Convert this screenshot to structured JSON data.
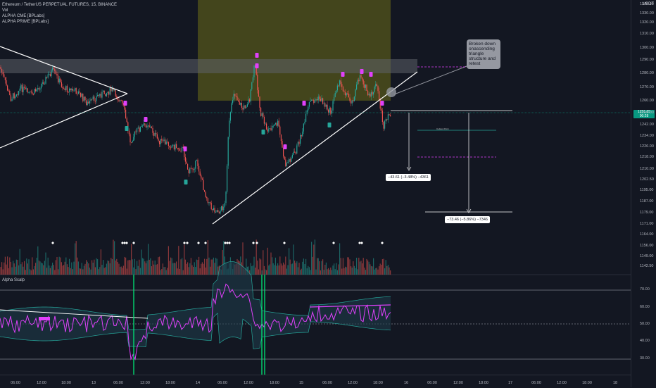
{
  "legend": {
    "title": "Ethereum / TetherUS PERPETUAL FUTURES, 15, BINANCE",
    "indicators": [
      "Vol",
      "ALPHA CME [BPLabs]",
      "ALPHA PRIME [BPLabs]"
    ]
  },
  "currency": "USDT",
  "price_axis": [
    "1340.00",
    "1330.00",
    "1320.00",
    "1310.00",
    "1300.00",
    "1290.00",
    "1280.00",
    "1270.00",
    "1260.00",
    "1250.00",
    "1242.00",
    "1234.00",
    "1226.00",
    "1218.00",
    "1210.00",
    "1202.50",
    "1195.00",
    "1187.00",
    "1179.00",
    "1171.00",
    "1164.00",
    "1156.00",
    "1149.00",
    "1142.50"
  ],
  "current_price": {
    "value": "1251.65",
    "countdown": "00:28"
  },
  "callout": {
    "text": "Broken down onascending triangle structure and retest"
  },
  "measures": [
    {
      "text": "−43.61 (−3.48%) −4361"
    },
    {
      "text": "−73.46 (−5.86%) −7346"
    }
  ],
  "target_label": "Celsius Point",
  "oscillator": {
    "title": "Alpha Scalp",
    "axis": [
      "70.00",
      "60.00",
      "50.00",
      "40.00",
      "30.00"
    ]
  },
  "time_axis": [
    "06:00",
    "12:00",
    "18:00",
    "13",
    "06:00",
    "12:00",
    "18:00",
    "14",
    "06:00",
    "12:00",
    "18:00",
    "15",
    "06:00",
    "12:00",
    "18:00",
    "16",
    "06:00",
    "12:00",
    "18:00",
    "17",
    "06:00",
    "12:00",
    "18:00",
    "18"
  ],
  "colors": {
    "background": "#131722",
    "bull": "#26a69a",
    "bear": "#ef5350",
    "magenta": "#e040fb",
    "green_line": "#00e676",
    "zone_yellow": "#6b6b18",
    "zone_gray": "#5d6068"
  }
}
